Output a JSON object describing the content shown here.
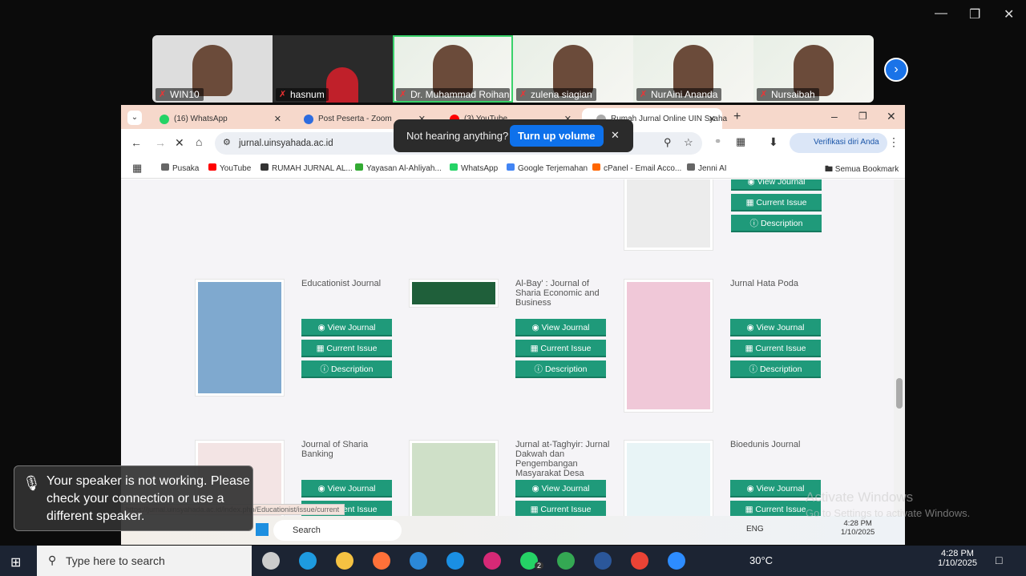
{
  "zoom": {
    "participants": [
      {
        "name": "WIN10"
      },
      {
        "name": "hasnum"
      },
      {
        "name": "Dr. Muhammad Roihan ...",
        "active": true
      },
      {
        "name": "zulena siagian"
      },
      {
        "name": "NurAini Ananda"
      },
      {
        "name": "Nursaibah"
      }
    ],
    "toast": {
      "text": "Not hearing anything?",
      "button": "Turn up volume"
    },
    "speaker_warning": "Your speaker is not working. Please check your connection or use a different speaker."
  },
  "browser": {
    "tabs": [
      {
        "label": "(16) WhatsApp",
        "color": "#25d366"
      },
      {
        "label": "Post Peserta - Zoom",
        "color": "#2d6cdf"
      },
      {
        "label": "(3) YouTube",
        "color": "#ff0000"
      },
      {
        "label": "Rumah Jurnal Online UIN Syaha",
        "color": "#aaaaaa",
        "current": true
      }
    ],
    "url": "jurnal.uinsyahada.ac.id",
    "profile": "Verifikasi diri Anda",
    "bookmarks": [
      "Pusaka",
      "YouTube",
      "RUMAH JURNAL AL...",
      "Yayasan Al-Ahliyah...",
      "WhatsApp",
      "Google Terjemahan",
      "cPanel - Email Acco...",
      "Jenni AI"
    ],
    "all_bookmarks": "Semua Bookmark",
    "status_url": "https://jurnal.uinsyahada.ac.id/index.php/Educationist/issue/current"
  },
  "buttons": {
    "view": "View Journal",
    "current": "Current Issue",
    "description": "Description"
  },
  "journals": [
    {
      "title": "Educationist Journal",
      "cover": "#7fa9cf"
    },
    {
      "title": "Al-Bay' : Journal of Sharia Economic and Business",
      "cover": "#1f5f3a"
    },
    {
      "title": "Jurnal Hata Poda",
      "cover": "#f0c8d8"
    },
    {
      "title": "Journal of Sharia Banking",
      "cover": "#f3e4e4"
    },
    {
      "title": "Jurnal at-Taghyir: Jurnal Dakwah dan Pengembangan Masyarakat Desa",
      "cover": "#cfe0c8"
    },
    {
      "title": "Bioedunis Journal",
      "cover": "#e8f4f6"
    }
  ],
  "inner_taskbar": {
    "search": "Search",
    "lang": "ENG",
    "time": "4:28 PM",
    "date": "1/10/2025"
  },
  "taskbar": {
    "search": "Type here to search",
    "weather": "30°C",
    "time": "4:28 PM",
    "date": "1/10/2025",
    "whatsapp_badge": "2"
  },
  "watermark": {
    "title": "Activate Windows",
    "sub": "Go to Settings to activate Windows."
  }
}
